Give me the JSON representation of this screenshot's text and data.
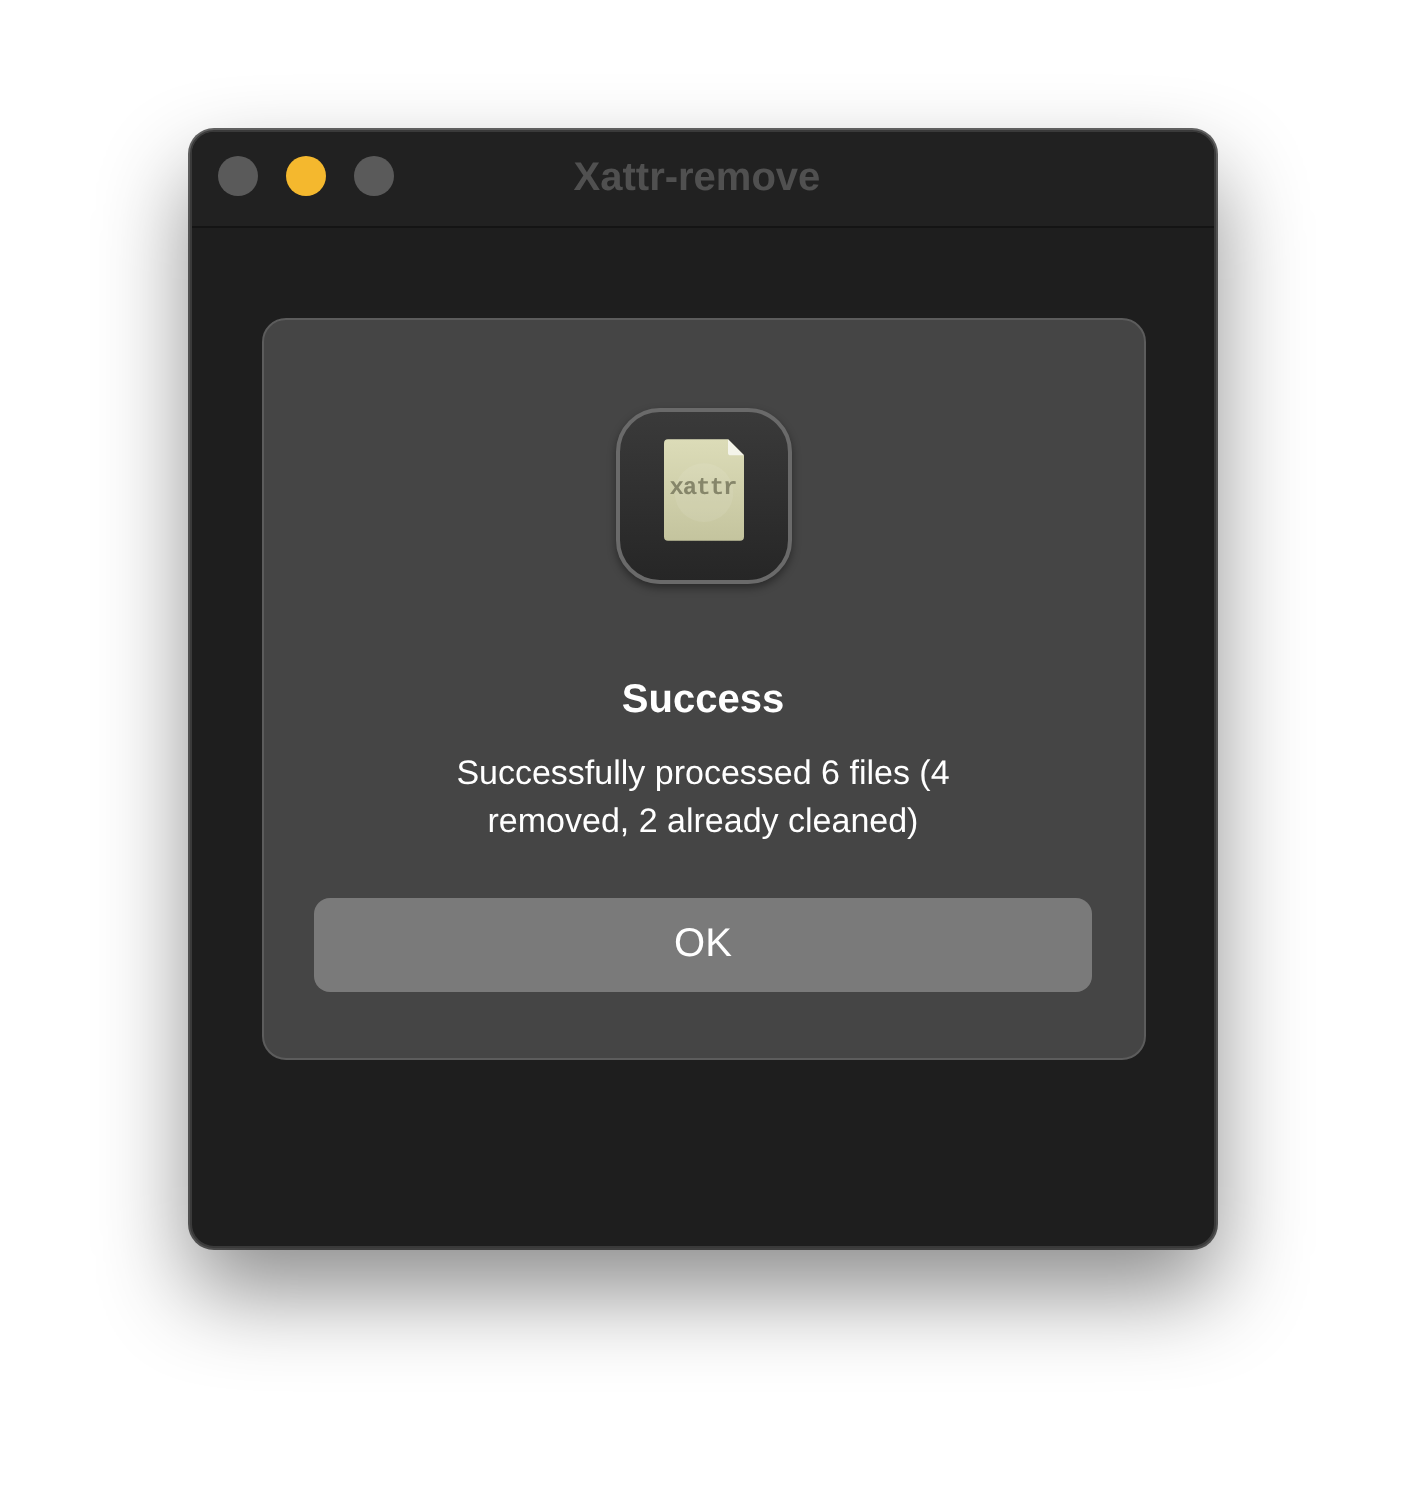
{
  "window": {
    "title": "Xattr-remove",
    "traffic_lights": [
      {
        "kind": "close",
        "enabled": false
      },
      {
        "kind": "minimize",
        "enabled": true
      },
      {
        "kind": "zoom",
        "enabled": false
      }
    ]
  },
  "dialog": {
    "icon_text": "xattr",
    "title": "Success",
    "message": "Successfully processed 6 files (4 removed, 2 already cleaned)",
    "buttons": [
      {
        "label": "OK"
      }
    ]
  }
}
